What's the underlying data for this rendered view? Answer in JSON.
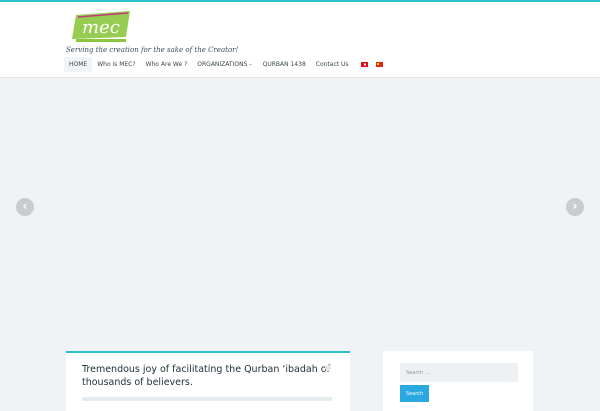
{
  "brand": {
    "logo_text": "mec",
    "tagline": "Serving the creation for the sake of the Creator!",
    "accent_color": "#2dc1c9",
    "logo_color": "#8cc63f"
  },
  "nav": {
    "items": [
      {
        "label": "HOME"
      },
      {
        "label": "Who is MEC?"
      },
      {
        "label": "Who Are We ?"
      },
      {
        "label": "ORGANIZATIONS"
      },
      {
        "label": "QURBAN 1438"
      },
      {
        "label": "Contact Us"
      }
    ],
    "flags": [
      "turkish-flag-icon",
      "chinese-flag-icon"
    ]
  },
  "slider": {
    "prev_icon": "‹",
    "next_icon": "›"
  },
  "post": {
    "title": "Tremendous joy of facilitating the Qurban ‘ibadah of thousands of believers."
  },
  "sidebar": {
    "search_placeholder": "Search …",
    "search_button": "Search"
  }
}
